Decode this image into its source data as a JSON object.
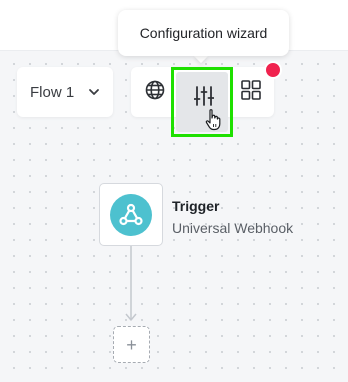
{
  "tooltip": {
    "text": "Configuration wizard"
  },
  "flow_selector": {
    "value": "Flow 1",
    "icon": "chevron-down-icon"
  },
  "toolbar": {
    "buttons": [
      {
        "name": "globe-button",
        "icon": "globe-icon"
      },
      {
        "name": "configuration-wizard-button",
        "icon": "sliders-icon",
        "highlighted": true
      },
      {
        "name": "grid-button",
        "icon": "grid-icon"
      }
    ],
    "notification_color": "#f0224e"
  },
  "trigger": {
    "title": "Trigger",
    "subtitle": "Universal Webhook",
    "icon": "webhook-icon",
    "icon_color": "#4dc1cf"
  },
  "add_step": {
    "label": "+",
    "icon": "plus-icon"
  },
  "colors": {
    "highlight": "#1ee000",
    "canvas": "#f5f6f8",
    "active_button": "#e4e6e9"
  }
}
